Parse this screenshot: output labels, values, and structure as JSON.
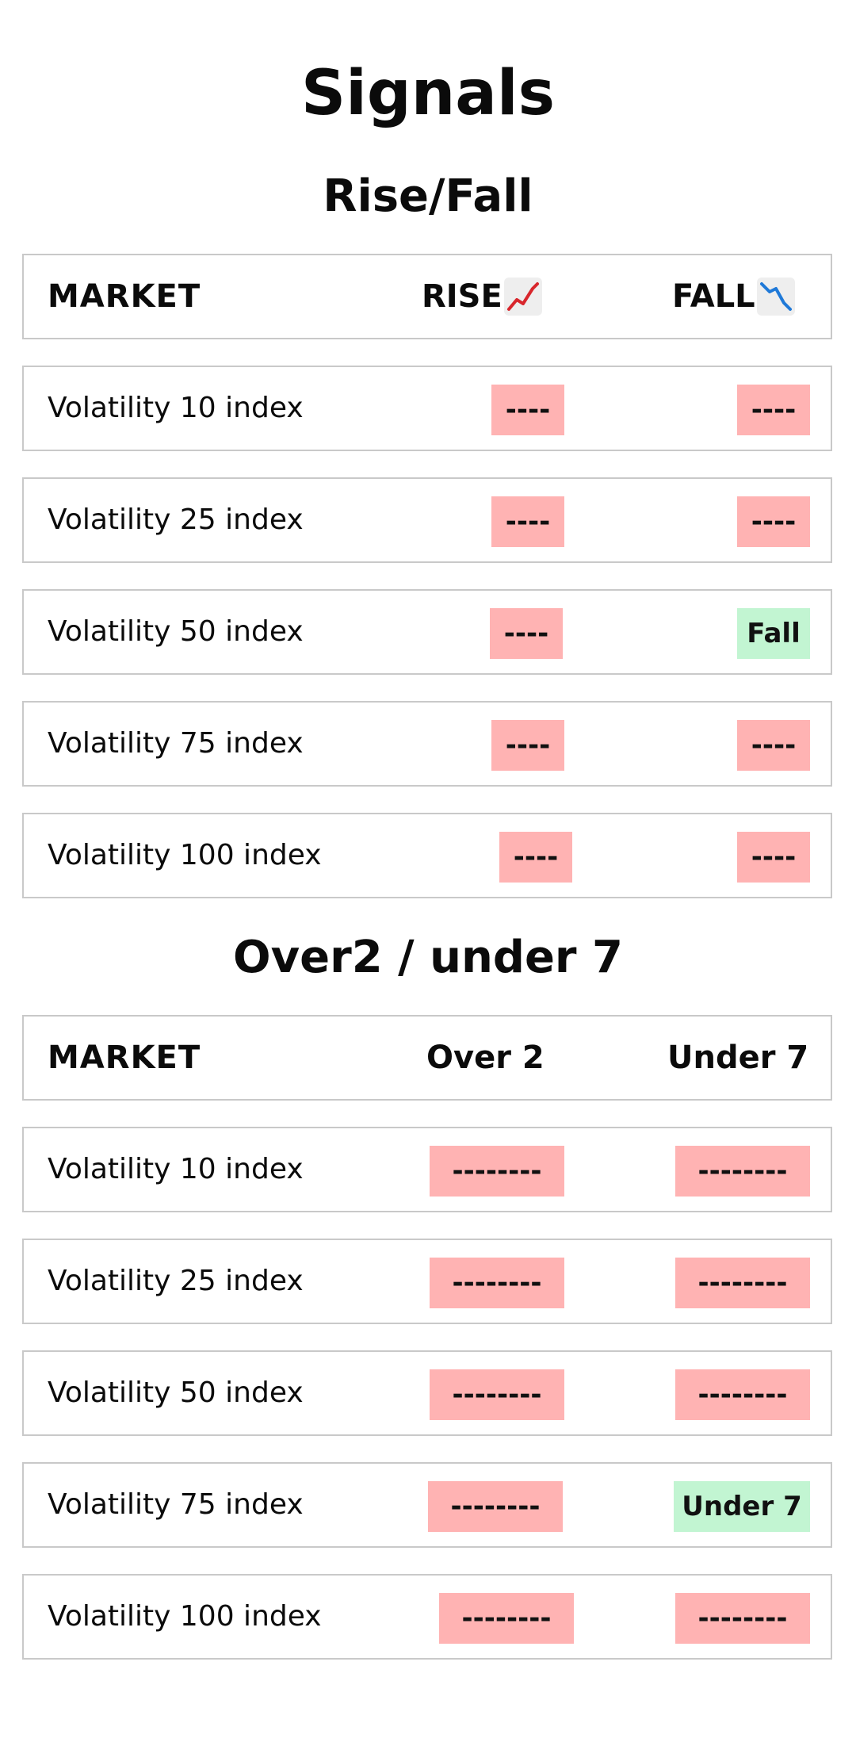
{
  "title": "Signals",
  "colors": {
    "inactive_badge": "#ffb3b3",
    "active_badge": "#c2f5d2",
    "border": "#c9c9c9"
  },
  "rise_fall": {
    "title": "Rise/Fall",
    "header": {
      "market": "MARKET",
      "rise": "RISE",
      "rise_icon": "chart-increasing-icon",
      "fall": "FALL",
      "fall_icon": "chart-decreasing-icon"
    },
    "rows": [
      {
        "market": "Volatility 10 index",
        "rise": "----",
        "rise_active": false,
        "fall": "----",
        "fall_active": false
      },
      {
        "market": "Volatility 25 index",
        "rise": "----",
        "rise_active": false,
        "fall": "----",
        "fall_active": false
      },
      {
        "market": "Volatility 50 index",
        "rise": "----",
        "rise_active": false,
        "fall": "Fall",
        "fall_active": true
      },
      {
        "market": "Volatility 75 index",
        "rise": "----",
        "rise_active": false,
        "fall": "----",
        "fall_active": false
      },
      {
        "market": "Volatility 100 index",
        "rise": "----",
        "rise_active": false,
        "fall": "----",
        "fall_active": false
      }
    ]
  },
  "over_under": {
    "title": "Over2 / under 7",
    "header": {
      "market": "MARKET",
      "over": "Over 2",
      "under": "Under 7"
    },
    "rows": [
      {
        "market": "Volatility 10 index",
        "over": "--------",
        "over_active": false,
        "under": "--------",
        "under_active": false
      },
      {
        "market": "Volatility 25 index",
        "over": "--------",
        "over_active": false,
        "under": "--------",
        "under_active": false
      },
      {
        "market": "Volatility 50 index",
        "over": "--------",
        "over_active": false,
        "under": "--------",
        "under_active": false
      },
      {
        "market": "Volatility 75 index",
        "over": "--------",
        "over_active": false,
        "under": "Under 7",
        "under_active": true
      },
      {
        "market": "Volatility 100 index",
        "over": "--------",
        "over_active": false,
        "under": "--------",
        "under_active": false
      }
    ]
  }
}
